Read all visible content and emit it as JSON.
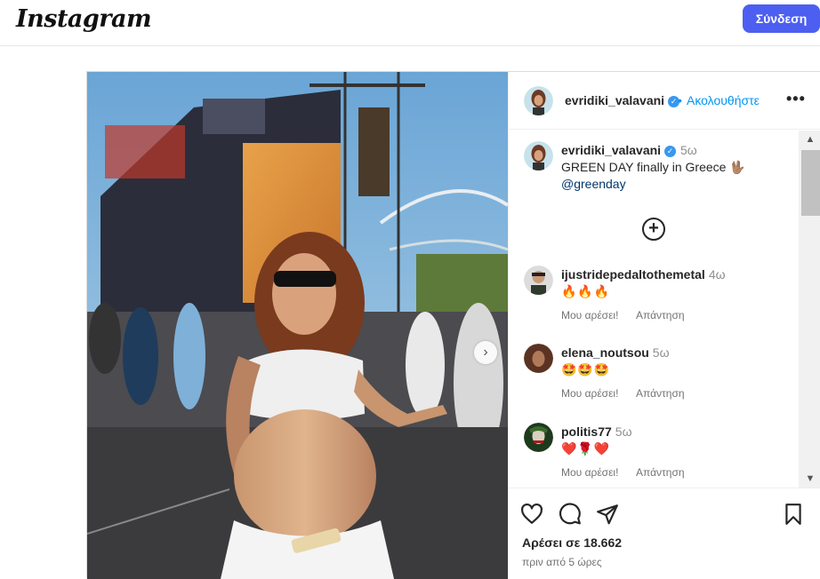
{
  "topbar": {
    "logo": "Instagram",
    "login_label": "Σύνδεση"
  },
  "post": {
    "author": "evridiki_valavani",
    "follow_dot": "•",
    "follow_label": "Ακολουθήστε",
    "more_label": "•••",
    "caption": {
      "author": "evridiki_valavani",
      "time": "5ω",
      "text": "GREEN DAY finally in Greece 🖖🏽",
      "mention": "@greenday"
    },
    "load_more_label": "+",
    "comments": [
      {
        "user": "ijustridepedaltothemetal",
        "time": "4ω",
        "text": "🔥🔥🔥",
        "like_label": "Μου αρέσει!",
        "reply_label": "Απάντηση"
      },
      {
        "user": "elena_noutsou",
        "time": "5ω",
        "text": "🤩🤩🤩",
        "like_label": "Μου αρέσει!",
        "reply_label": "Απάντηση"
      },
      {
        "user": "politis77",
        "time": "5ω",
        "text": "❤️🌹❤️",
        "like_label": "Μου αρέσει!",
        "reply_label": "Απάντηση"
      }
    ],
    "likes_text": "Αρέσει σε 18.662",
    "time_ago": "πριν από 5 ώρες"
  },
  "icons": [
    "like-icon",
    "comment-icon",
    "share-icon",
    "save-icon",
    "more-options-icon",
    "verified-icon"
  ],
  "colors": {
    "accent": "#4c5ff0",
    "link": "#0095f6",
    "verified": "#3897f0"
  }
}
